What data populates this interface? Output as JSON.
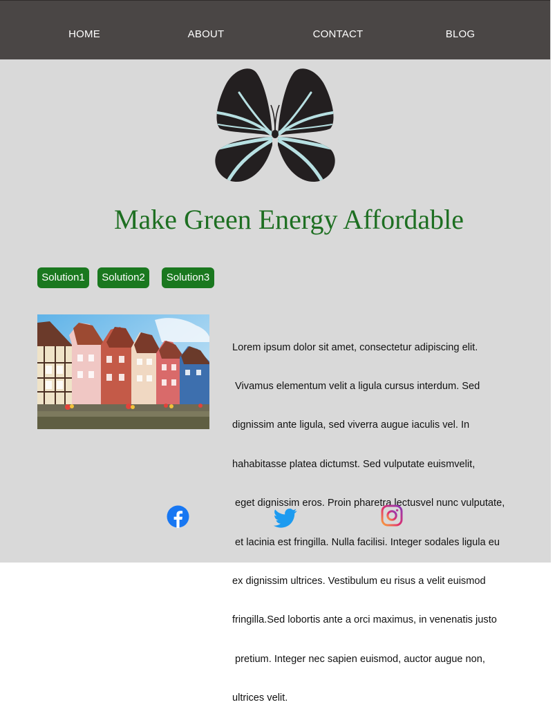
{
  "nav": {
    "items": [
      "HOME",
      "ABOUT",
      "CONTACT",
      "BLOG"
    ]
  },
  "logo": {
    "icon": "butterfly-logo-icon",
    "colors": {
      "body": "#231f20",
      "stripe": "#b7e0e2"
    }
  },
  "hero": {
    "headline": "Make Green Energy Affordable",
    "color": "#1e6f22"
  },
  "solutions": {
    "buttons": [
      "Solution1",
      "Solution2",
      "Solution3"
    ],
    "color": "#1a781f"
  },
  "content": {
    "image": "colorful-half-timbered-houses-photo",
    "paragraph_lines": [
      "Lorem ipsum dolor sit amet, consectetur adipiscing elit.",
      " Vivamus elementum velit a ligula cursus interdum. Sed",
      "dignissim ante ligula, sed viverra augue iaculis vel. In",
      "hahabitasse platea dictumst. Sed vulputate euismvelit,",
      " eget dignissim eros. Proin pharetra lectusvel nunc vulputate,",
      " et lacinia est fringilla. Nulla facilisi. Integer sodales ligula eu",
      "ex dignissim ultrices. Vestibulum eu risus a velit euismod",
      "fringilla.Sed lobortis ante a orci maximus, in venenatis justo",
      " pretium. Integer nec sapien euismod, auctor augue non,",
      "ultrices velit."
    ]
  },
  "social": {
    "icons": [
      "facebook-icon",
      "twitter-icon",
      "instagram-icon"
    ]
  },
  "colors": {
    "nav_bg": "#4a4645",
    "page_bg": "#d9d9d9"
  }
}
